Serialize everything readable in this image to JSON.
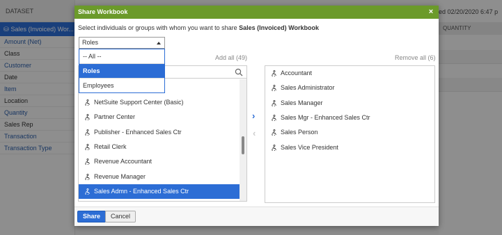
{
  "background": {
    "dataset_header": "DATASET",
    "dataset_name": "Sales (Invoiced) Wor...",
    "fields": [
      {
        "label": "Amount (Net)",
        "style": "blue"
      },
      {
        "label": "Class",
        "style": "dark"
      },
      {
        "label": "Customer",
        "style": "blue"
      },
      {
        "label": "Date",
        "style": "dark"
      },
      {
        "label": "Item",
        "style": "blue"
      },
      {
        "label": "Location",
        "style": "dark"
      },
      {
        "label": "Quantity",
        "style": "blue"
      },
      {
        "label": "Sales Rep",
        "style": "dark"
      },
      {
        "label": "Transaction",
        "style": "blue"
      },
      {
        "label": "Transaction Type",
        "style": "blue"
      }
    ],
    "saved_text": "ed 02/20/2020 6:47 p",
    "column_header": "QUANTITY"
  },
  "dialog": {
    "title": "Share Workbook",
    "close_label": "×",
    "instruction_prefix": "Select individuals or groups with whom you want to share",
    "workbook_name": "Sales (Invoiced)",
    "instruction_suffix": "Workbook",
    "select_value": "Roles",
    "dropdown_options": [
      "-- All --",
      "Roles",
      "Employees"
    ],
    "add_all": "Add all (49)",
    "remove_all": "Remove all (6)",
    "available": [
      "NetSuite Support Center (Basic)",
      "Partner Center",
      "Publisher - Enhanced Sales Ctr",
      "Retail Clerk",
      "Revenue Accountant",
      "Revenue Manager",
      "Sales Admn - Enhanced Sales Ctr"
    ],
    "selected": [
      "Accountant",
      "Sales Administrator",
      "Sales Manager",
      "Sales Mgr - Enhanced Sales Ctr",
      "Sales Person",
      "Sales Vice President"
    ],
    "share_label": "Share",
    "cancel_label": "Cancel",
    "accent_color": "#2c6dd5",
    "title_color": "#6b9a2a"
  }
}
